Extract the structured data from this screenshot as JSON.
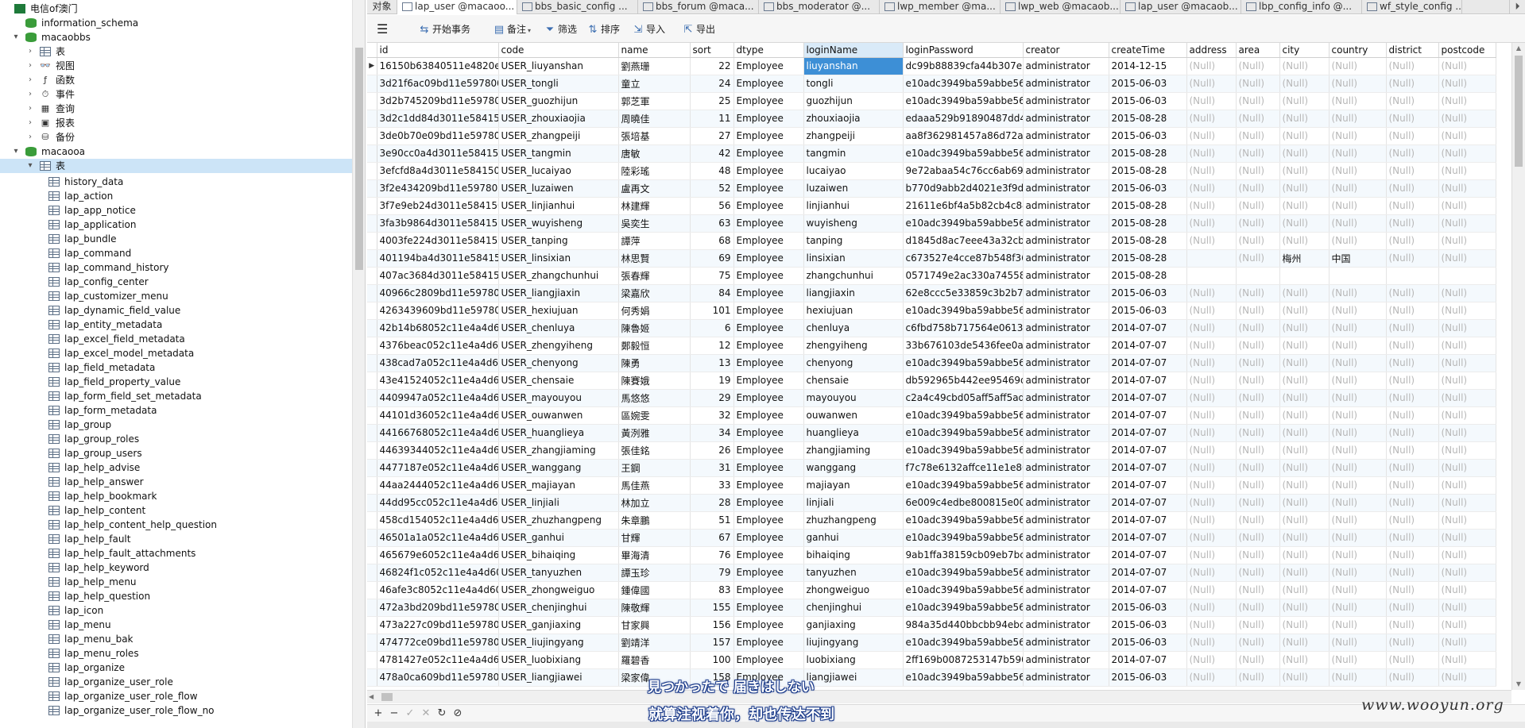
{
  "tree": {
    "connection": "电信of澳门",
    "nodes": [
      {
        "label": "information_schema",
        "kind": "db",
        "level": 1,
        "arrow": ""
      },
      {
        "label": "macaobbs",
        "kind": "db",
        "level": 1,
        "arrow": "▾"
      },
      {
        "label": "表",
        "kind": "table",
        "level": 2,
        "arrow": "›"
      },
      {
        "label": "视图",
        "kind": "view",
        "level": 2,
        "arrow": "›"
      },
      {
        "label": "函数",
        "kind": "func",
        "level": 2,
        "arrow": "›"
      },
      {
        "label": "事件",
        "kind": "event",
        "level": 2,
        "arrow": "›"
      },
      {
        "label": "查询",
        "kind": "query",
        "level": 2,
        "arrow": "›"
      },
      {
        "label": "报表",
        "kind": "report",
        "level": 2,
        "arrow": "›"
      },
      {
        "label": "备份",
        "kind": "backup",
        "level": 2,
        "arrow": "›"
      },
      {
        "label": "macaooa",
        "kind": "db",
        "level": 1,
        "arrow": "▾"
      },
      {
        "label": "表",
        "kind": "table",
        "level": 2,
        "arrow": "▾",
        "selected": true
      }
    ],
    "tables": [
      "history_data",
      "lap_action",
      "lap_app_notice",
      "lap_application",
      "lap_bundle",
      "lap_command",
      "lap_command_history",
      "lap_config_center",
      "lap_customizer_menu",
      "lap_dynamic_field_value",
      "lap_entity_metadata",
      "lap_excel_field_metadata",
      "lap_excel_model_metadata",
      "lap_field_metadata",
      "lap_field_property_value",
      "lap_form_field_set_metadata",
      "lap_form_metadata",
      "lap_group",
      "lap_group_roles",
      "lap_group_users",
      "lap_help_advise",
      "lap_help_answer",
      "lap_help_bookmark",
      "lap_help_content",
      "lap_help_content_help_question",
      "lap_help_fault",
      "lap_help_fault_attachments",
      "lap_help_keyword",
      "lap_help_menu",
      "lap_help_question",
      "lap_icon",
      "lap_menu",
      "lap_menu_bak",
      "lap_menu_roles",
      "lap_organize",
      "lap_organize_user_role",
      "lap_organize_user_role_flow",
      "lap_organize_user_role_flow_no"
    ]
  },
  "tabs": [
    {
      "label": "对象",
      "first": true
    },
    {
      "label": "lap_user @macaoo...",
      "active": true
    },
    {
      "label": "bbs_basic_config ..."
    },
    {
      "label": "bbs_forum @maca..."
    },
    {
      "label": "bbs_moderator @..."
    },
    {
      "label": "lwp_member @ma..."
    },
    {
      "label": "lwp_web @macaob..."
    },
    {
      "label": "lap_user @macaob..."
    },
    {
      "label": "lbp_config_info @..."
    },
    {
      "label": "wf_style_config ..."
    }
  ],
  "tab_overflow": "⏵",
  "toolbar": {
    "menu": "☰",
    "begin_tx": "开始事务",
    "note": "备注",
    "filter": "筛选",
    "sort": "排序",
    "import": "导入",
    "export": "导出"
  },
  "columns": [
    "id",
    "code",
    "name",
    "sort",
    "dtype",
    "loginName",
    "loginPassword",
    "creator",
    "createTime",
    "address",
    "area",
    "city",
    "country",
    "district",
    "postcode"
  ],
  "rows": [
    [
      "16150b63840511e4820ec",
      "USER_liuyanshan",
      "劉燕珊",
      "22",
      "Employee",
      "liuyanshan",
      "dc99b88839cfa44b307e3",
      "administrator",
      "2014-12-15",
      "(Null)",
      "(Null)",
      "(Null)",
      "(Null)",
      "(Null)",
      "(Null)"
    ],
    [
      "3d21f6ac09bd11e597800",
      "USER_tongli",
      "童立",
      "24",
      "Employee",
      "tongli",
      "e10adc3949ba59abbe56e",
      "administrator",
      "2015-06-03",
      "(Null)",
      "(Null)",
      "(Null)",
      "(Null)",
      "(Null)",
      "(Null)"
    ],
    [
      "3d2b745209bd11e597800",
      "USER_guozhijun",
      "郭芝軍",
      "25",
      "Employee",
      "guozhijun",
      "e10adc3949ba59abbe56e",
      "administrator",
      "2015-06-03",
      "(Null)",
      "(Null)",
      "(Null)",
      "(Null)",
      "(Null)",
      "(Null)"
    ],
    [
      "3d2c1dd84d3011e58415C",
      "USER_zhouxiaojia",
      "周曉佳",
      "11",
      "Employee",
      "zhouxiaojia",
      "edaaa529b91890487dd4",
      "administrator",
      "2015-08-28",
      "(Null)",
      "(Null)",
      "(Null)",
      "(Null)",
      "(Null)",
      "(Null)"
    ],
    [
      "3de0b70e09bd11e597800",
      "USER_zhangpeiji",
      "張培基",
      "27",
      "Employee",
      "zhangpeiji",
      "aa8f362981457a86d72a7",
      "administrator",
      "2015-06-03",
      "(Null)",
      "(Null)",
      "(Null)",
      "(Null)",
      "(Null)",
      "(Null)"
    ],
    [
      "3e90cc0a4d3011e5841500",
      "USER_tangmin",
      "唐敏",
      "42",
      "Employee",
      "tangmin",
      "e10adc3949ba59abbe56e",
      "administrator",
      "2015-08-28",
      "(Null)",
      "(Null)",
      "(Null)",
      "(Null)",
      "(Null)",
      "(Null)"
    ],
    [
      "3efcfd8a4d3011e5841500",
      "USER_lucaiyao",
      "陸彩瑤",
      "48",
      "Employee",
      "lucaiyao",
      "9e72abaa54c76cc6ab692",
      "administrator",
      "2015-08-28",
      "(Null)",
      "(Null)",
      "(Null)",
      "(Null)",
      "(Null)",
      "(Null)"
    ],
    [
      "3f2e434209bd11e597800",
      "USER_luzaiwen",
      "盧再文",
      "52",
      "Employee",
      "luzaiwen",
      "b770d9abb2d4021e3f9d1",
      "administrator",
      "2015-06-03",
      "(Null)",
      "(Null)",
      "(Null)",
      "(Null)",
      "(Null)",
      "(Null)"
    ],
    [
      "3f7e9eb24d3011e5841500",
      "USER_linjianhui",
      "林建輝",
      "56",
      "Employee",
      "linjianhui",
      "21611e6bf4a5b82cb4c84",
      "administrator",
      "2015-08-28",
      "(Null)",
      "(Null)",
      "(Null)",
      "(Null)",
      "(Null)",
      "(Null)"
    ],
    [
      "3fa3b9864d3011e5841500",
      "USER_wuyisheng",
      "吳奕生",
      "63",
      "Employee",
      "wuyisheng",
      "e10adc3949ba59abbe56e",
      "administrator",
      "2015-08-28",
      "(Null)",
      "(Null)",
      "(Null)",
      "(Null)",
      "(Null)",
      "(Null)"
    ],
    [
      "4003fe224d3011e5841500",
      "USER_tanping",
      "譚萍",
      "68",
      "Employee",
      "tanping",
      "d1845d8ac7eee43a32cb8",
      "administrator",
      "2015-08-28",
      "(Null)",
      "(Null)",
      "(Null)",
      "(Null)",
      "(Null)",
      "(Null)"
    ],
    [
      "401194ba4d3011e584150",
      "USER_linsixian",
      "林思賢",
      "69",
      "Employee",
      "linsixian",
      "c673527e4cce87b548f360",
      "administrator",
      "2015-08-28",
      "",
      "(Null)",
      "梅州",
      "中国",
      "(Null)",
      "(Null)"
    ],
    [
      "407ac3684d3011e584150",
      "USER_zhangchunhui",
      "張春輝",
      "75",
      "Employee",
      "zhangchunhui",
      "0571749e2ac330a745580",
      "administrator",
      "2015-08-28",
      "",
      "",
      "",
      "",
      "",
      ""
    ],
    [
      "40966c2809bd11e597800",
      "USER_liangjiaxin",
      "梁嘉欣",
      "84",
      "Employee",
      "liangjiaxin",
      "62e8ccc5e33859c3b2b7b",
      "administrator",
      "2015-06-03",
      "(Null)",
      "(Null)",
      "(Null)",
      "(Null)",
      "(Null)",
      "(Null)"
    ],
    [
      "4263439609bd11e597800",
      "USER_hexiujuan",
      "何秀娟",
      "101",
      "Employee",
      "hexiujuan",
      "e10adc3949ba59abbe56e",
      "administrator",
      "2015-06-03",
      "(Null)",
      "(Null)",
      "(Null)",
      "(Null)",
      "(Null)",
      "(Null)"
    ],
    [
      "42b14b68052c11e4a4d60",
      "USER_chenluya",
      "陳魯姬",
      "6",
      "Employee",
      "chenluya",
      "c6fbd758b717564e0613a",
      "administrator",
      "2014-07-07",
      "(Null)",
      "(Null)",
      "(Null)",
      "(Null)",
      "(Null)",
      "(Null)"
    ],
    [
      "4376beac052c11e4a4d60",
      "USER_zhengyiheng",
      "鄭毅恒",
      "12",
      "Employee",
      "zhengyiheng",
      "33b676103de5436fee0aa",
      "administrator",
      "2014-07-07",
      "(Null)",
      "(Null)",
      "(Null)",
      "(Null)",
      "(Null)",
      "(Null)"
    ],
    [
      "438cad7a052c11e4a4d60",
      "USER_chenyong",
      "陳勇",
      "13",
      "Employee",
      "chenyong",
      "e10adc3949ba59abbe56e",
      "administrator",
      "2014-07-07",
      "(Null)",
      "(Null)",
      "(Null)",
      "(Null)",
      "(Null)",
      "(Null)"
    ],
    [
      "43e41524052c11e4a4d60",
      "USER_chensaie",
      "陳賽娥",
      "19",
      "Employee",
      "chensaie",
      "db592965b442ee95469dc",
      "administrator",
      "2014-07-07",
      "(Null)",
      "(Null)",
      "(Null)",
      "(Null)",
      "(Null)",
      "(Null)"
    ],
    [
      "4409947a052c11e4a4d60",
      "USER_mayouyou",
      "馬悠悠",
      "29",
      "Employee",
      "mayouyou",
      "c2a4c49cbd05aff5aff5adt",
      "administrator",
      "2014-07-07",
      "(Null)",
      "(Null)",
      "(Null)",
      "(Null)",
      "(Null)",
      "(Null)"
    ],
    [
      "44101d36052c11e4a4d60",
      "USER_ouwanwen",
      "區婉雯",
      "32",
      "Employee",
      "ouwanwen",
      "e10adc3949ba59abbe56e",
      "administrator",
      "2014-07-07",
      "(Null)",
      "(Null)",
      "(Null)",
      "(Null)",
      "(Null)",
      "(Null)"
    ],
    [
      "44166768052c11e4a4d60",
      "USER_huanglieya",
      "黃洌雅",
      "34",
      "Employee",
      "huanglieya",
      "e10adc3949ba59abbe56e",
      "administrator",
      "2014-07-07",
      "(Null)",
      "(Null)",
      "(Null)",
      "(Null)",
      "(Null)",
      "(Null)"
    ],
    [
      "44639344052c11e4a4d60",
      "USER_zhangjiaming",
      "張佳銘",
      "26",
      "Employee",
      "zhangjiaming",
      "e10adc3949ba59abbe56e",
      "administrator",
      "2014-07-07",
      "(Null)",
      "(Null)",
      "(Null)",
      "(Null)",
      "(Null)",
      "(Null)"
    ],
    [
      "4477187e052c11e4a4d60",
      "USER_wanggang",
      "王鋼",
      "31",
      "Employee",
      "wanggang",
      "f7c78e6132affce11e1e80c",
      "administrator",
      "2014-07-07",
      "(Null)",
      "(Null)",
      "(Null)",
      "(Null)",
      "(Null)",
      "(Null)"
    ],
    [
      "44aa2444052c11e4a4d60",
      "USER_majiayan",
      "馬佳燕",
      "33",
      "Employee",
      "majiayan",
      "e10adc3949ba59abbe56e",
      "administrator",
      "2014-07-07",
      "(Null)",
      "(Null)",
      "(Null)",
      "(Null)",
      "(Null)",
      "(Null)"
    ],
    [
      "44dd95cc052c11e4a4d60",
      "USER_linjiali",
      "林加立",
      "28",
      "Employee",
      "linjiali",
      "6e009c4edbe800815e006",
      "administrator",
      "2014-07-07",
      "(Null)",
      "(Null)",
      "(Null)",
      "(Null)",
      "(Null)",
      "(Null)"
    ],
    [
      "458cd154052c11e4a4d60",
      "USER_zhuzhangpeng",
      "朱章鵬",
      "51",
      "Employee",
      "zhuzhangpeng",
      "e10adc3949ba59abbe56e",
      "administrator",
      "2014-07-07",
      "(Null)",
      "(Null)",
      "(Null)",
      "(Null)",
      "(Null)",
      "(Null)"
    ],
    [
      "46501a1a052c11e4a4d60",
      "USER_ganhui",
      "甘輝",
      "67",
      "Employee",
      "ganhui",
      "e10adc3949ba59abbe56e",
      "administrator",
      "2014-07-07",
      "(Null)",
      "(Null)",
      "(Null)",
      "(Null)",
      "(Null)",
      "(Null)"
    ],
    [
      "465679e6052c11e4a4d60",
      "USER_bihaiqing",
      "畢海清",
      "76",
      "Employee",
      "bihaiqing",
      "9ab1ffa38159cb09eb7bc9",
      "administrator",
      "2014-07-07",
      "(Null)",
      "(Null)",
      "(Null)",
      "(Null)",
      "(Null)",
      "(Null)"
    ],
    [
      "46824f1c052c11e4a4d60C",
      "USER_tanyuzhen",
      "譚玉珍",
      "79",
      "Employee",
      "tanyuzhen",
      "e10adc3949ba59abbe56e",
      "administrator",
      "2014-07-07",
      "(Null)",
      "(Null)",
      "(Null)",
      "(Null)",
      "(Null)",
      "(Null)"
    ],
    [
      "46afe3c8052c11e4a4d60C",
      "USER_zhongweiguo",
      "鍾偉國",
      "83",
      "Employee",
      "zhongweiguo",
      "e10adc3949ba59abbe56e",
      "administrator",
      "2014-07-07",
      "(Null)",
      "(Null)",
      "(Null)",
      "(Null)",
      "(Null)",
      "(Null)"
    ],
    [
      "472a3bd209bd11e597800",
      "USER_chenjinghui",
      "陳敬輝",
      "155",
      "Employee",
      "chenjinghui",
      "e10adc3949ba59abbe56e",
      "administrator",
      "2015-06-03",
      "(Null)",
      "(Null)",
      "(Null)",
      "(Null)",
      "(Null)",
      "(Null)"
    ],
    [
      "473a227c09bd11e597800",
      "USER_ganjiaxing",
      "甘家興",
      "156",
      "Employee",
      "ganjiaxing",
      "984a35d440bbcbb94ebce",
      "administrator",
      "2015-06-03",
      "(Null)",
      "(Null)",
      "(Null)",
      "(Null)",
      "(Null)",
      "(Null)"
    ],
    [
      "474772ce09bd11e597800",
      "USER_liujingyang",
      "劉靖洋",
      "157",
      "Employee",
      "liujingyang",
      "e10adc3949ba59abbe56e",
      "administrator",
      "2015-06-03",
      "(Null)",
      "(Null)",
      "(Null)",
      "(Null)",
      "(Null)",
      "(Null)"
    ],
    [
      "4781427e052c11e4a4d60",
      "USER_luobixiang",
      "羅碧香",
      "100",
      "Employee",
      "luobixiang",
      "2ff169b0087253147b590c",
      "administrator",
      "2014-07-07",
      "(Null)",
      "(Null)",
      "(Null)",
      "(Null)",
      "(Null)",
      "(Null)"
    ],
    [
      "478a0ca609bd11e597800",
      "USER_liangjiawei",
      "梁家偉",
      "158",
      "Employee",
      "liangjiawei",
      "e10adc3949ba59abbe56e",
      "administrator",
      "2015-06-03",
      "(Null)",
      "(Null)",
      "(Null)",
      "(Null)",
      "(Null)",
      "(Null)"
    ]
  ],
  "bottom": {
    "add": "+",
    "remove": "−",
    "check": "✓",
    "cancel": "✕",
    "refresh": "↻",
    "stop": "⊘"
  },
  "watermark": "www.wooyun.org",
  "subtitles": [
    "見つかったで 届きはしない",
    "就算注视着你，却也传达不到"
  ]
}
